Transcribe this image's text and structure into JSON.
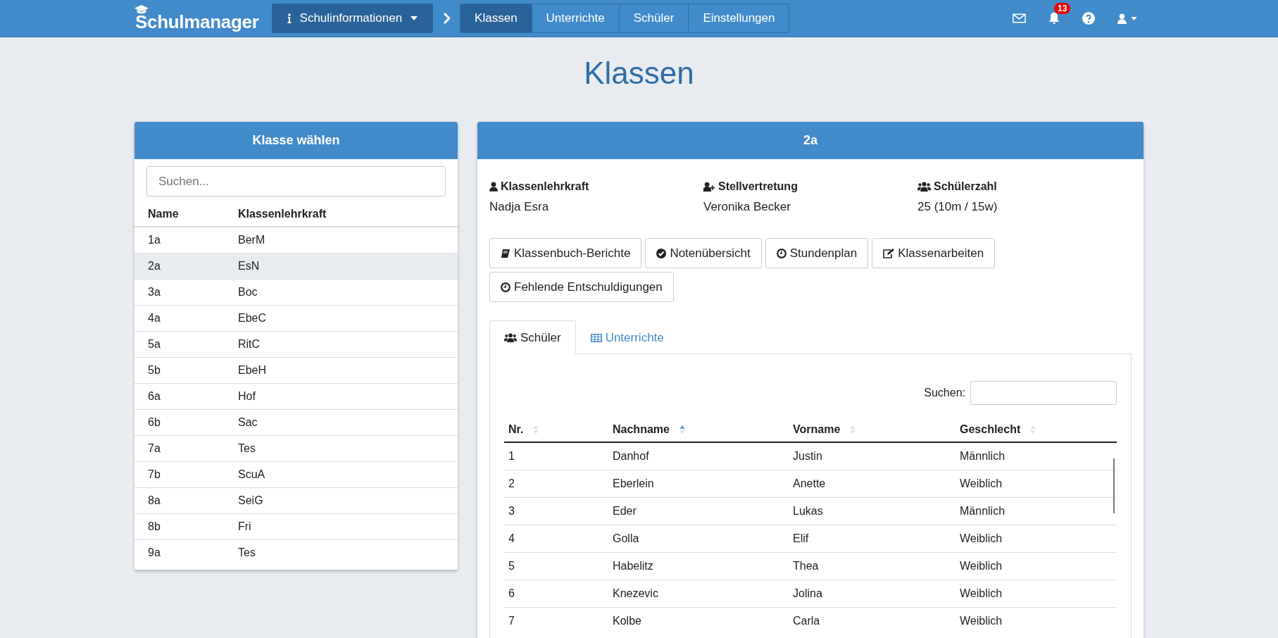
{
  "navbar": {
    "brand": "Schulmanager",
    "info_menu": "Schulinformationen",
    "nav": [
      {
        "label": "Klassen",
        "selected": true
      },
      {
        "label": "Unterrichte",
        "selected": false
      },
      {
        "label": "Schüler",
        "selected": false
      },
      {
        "label": "Einstellungen",
        "selected": false
      }
    ],
    "notification_count": "13"
  },
  "page_title": "Klassen",
  "class_picker": {
    "title": "Klasse wählen",
    "search": {
      "placeholder": "Suchen..."
    },
    "columns": [
      "Name",
      "Klassenlehrkraft"
    ],
    "rows": [
      {
        "name": "1a",
        "teacher": "BerM",
        "selected": false
      },
      {
        "name": "2a",
        "teacher": "EsN",
        "selected": true
      },
      {
        "name": "3a",
        "teacher": "Boc",
        "selected": false
      },
      {
        "name": "4a",
        "teacher": "EbeC",
        "selected": false
      },
      {
        "name": "5a",
        "teacher": "RitC",
        "selected": false
      },
      {
        "name": "5b",
        "teacher": "EbeH",
        "selected": false
      },
      {
        "name": "6a",
        "teacher": "Hof",
        "selected": false
      },
      {
        "name": "6b",
        "teacher": "Sac",
        "selected": false
      },
      {
        "name": "7a",
        "teacher": "Tes",
        "selected": false
      },
      {
        "name": "7b",
        "teacher": "ScuA",
        "selected": false
      },
      {
        "name": "8a",
        "teacher": "SeiG",
        "selected": false
      },
      {
        "name": "8b",
        "teacher": "Fri",
        "selected": false
      },
      {
        "name": "9a",
        "teacher": "Tes",
        "selected": false
      }
    ]
  },
  "class_detail": {
    "title": "2a",
    "info": [
      {
        "kind": "teacher",
        "label": "Klassenlehrkraft",
        "value": "Nadja Esra"
      },
      {
        "kind": "substitute",
        "label": "Stellvertretung",
        "value": "Veronika Becker"
      },
      {
        "kind": "count",
        "label": "Schülerzahl",
        "value": "25 (10m / 15w)"
      }
    ],
    "actions": [
      {
        "kind": "book",
        "label": "Klassenbuch-Berichte"
      },
      {
        "kind": "check",
        "label": "Notenübersicht"
      },
      {
        "kind": "clock",
        "label": "Stundenplan"
      },
      {
        "kind": "edit",
        "label": "Klassenarbeiten"
      },
      {
        "kind": "clock",
        "label": "Fehlende Entschuldigungen"
      }
    ],
    "tabs": [
      {
        "kind": "users",
        "label": "Schüler",
        "selected": true
      },
      {
        "kind": "table",
        "label": "Unterrichte",
        "selected": false
      }
    ],
    "search_label": "Suchen:",
    "table": {
      "columns": [
        {
          "label": "Nr.",
          "sorted_ascending": false
        },
        {
          "label": "Nachname",
          "sorted_ascending": true
        },
        {
          "label": "Vorname",
          "sorted_ascending": false
        },
        {
          "label": "Geschlecht",
          "sorted_ascending": false
        }
      ],
      "rows": [
        [
          "1",
          "Danhof",
          "Justin",
          "Männlich"
        ],
        [
          "2",
          "Eberlein",
          "Anette",
          "Weiblich"
        ],
        [
          "3",
          "Eder",
          "Lukas",
          "Männlich"
        ],
        [
          "4",
          "Golla",
          "Elif",
          "Weiblich"
        ],
        [
          "5",
          "Habelitz",
          "Thea",
          "Weiblich"
        ],
        [
          "6",
          "Knezevic",
          "Jolina",
          "Weiblich"
        ],
        [
          "7",
          "Kolbe",
          "Carla",
          "Weiblich"
        ]
      ]
    }
  }
}
